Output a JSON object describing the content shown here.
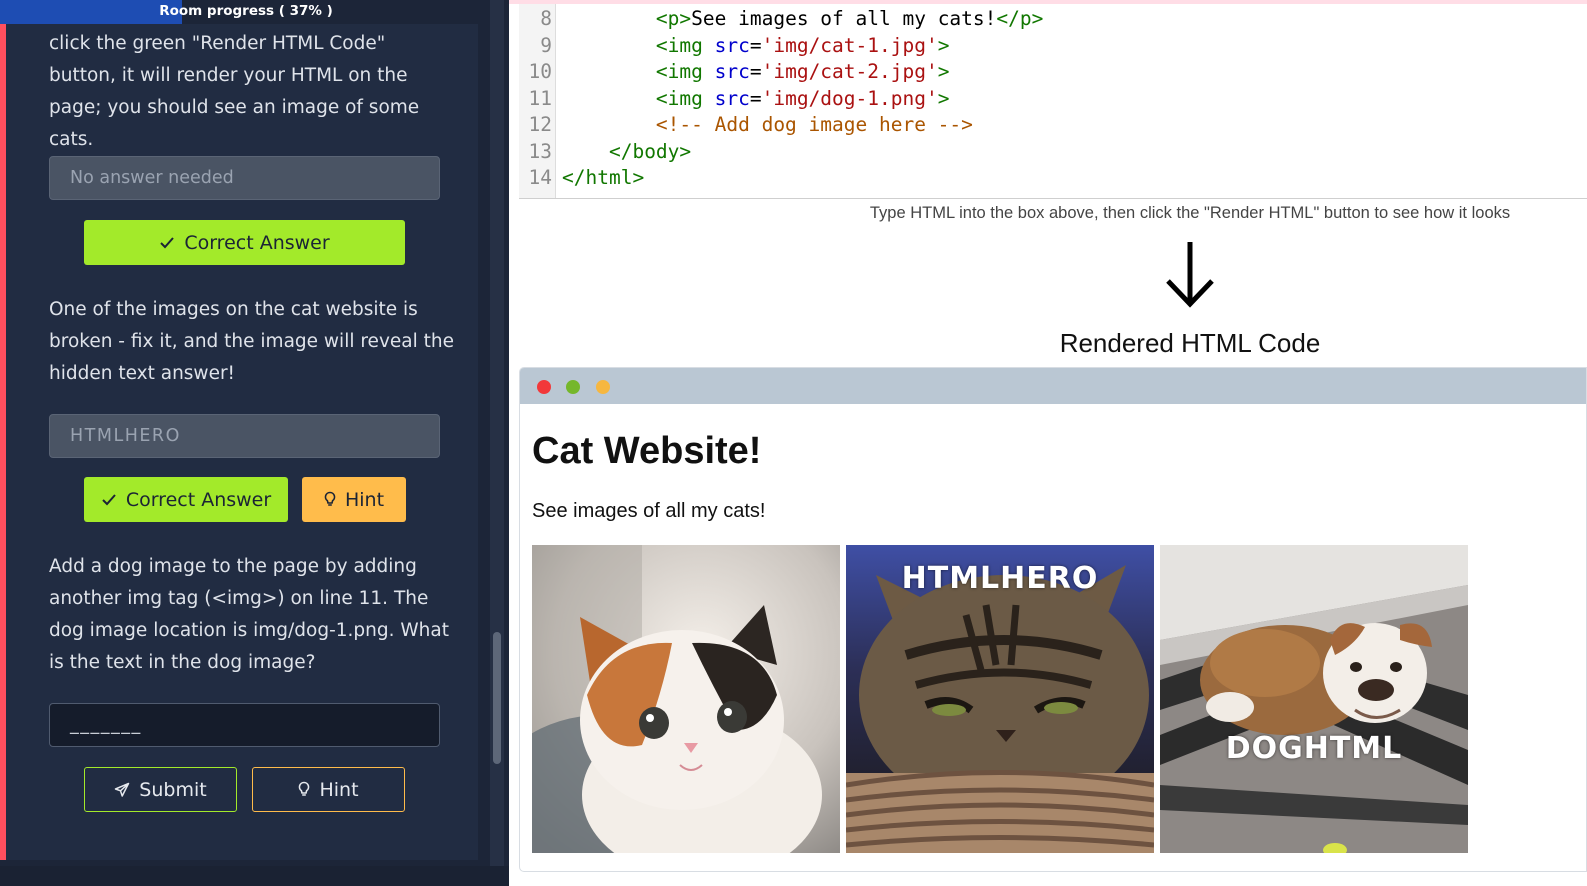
{
  "progress": {
    "label": "Room progress ( 37% )",
    "fraction": 0.37
  },
  "task": {
    "paragraph_0": "If you enter some HTML into the box and click the green \"Render HTML Code\" button, it will render your HTML on the page; you should see an image of some cats.",
    "answer_1": {
      "placeholder": "No answer needed"
    },
    "correct_label": "Correct Answer",
    "paragraph_1": "One of the images on the cat website is broken - fix it, and the image will reveal the hidden text answer!",
    "answer_2": {
      "value": "HTMLHERO"
    },
    "hint_label": "Hint",
    "paragraph_2": "Add a dog image to the page by adding another img tag (<img>) on line 11. The dog image location is img/dog-1.png. What is the text in the dog image?",
    "answer_3": {
      "value": "_______"
    },
    "submit_label": "Submit"
  },
  "editor": {
    "lines": [
      {
        "num": "8",
        "indent": "        ",
        "parts": [
          {
            "t": "tag",
            "v": "<p>"
          },
          {
            "t": "text",
            "v": "See images of all my cats!"
          },
          {
            "t": "tag",
            "v": "</p>"
          }
        ]
      },
      {
        "num": "9",
        "indent": "        ",
        "parts": [
          {
            "t": "tag",
            "v": "<img "
          },
          {
            "t": "attr",
            "v": "src"
          },
          {
            "t": "text",
            "v": "="
          },
          {
            "t": "str",
            "v": "'img/cat-1.jpg'"
          },
          {
            "t": "tag",
            "v": ">"
          }
        ]
      },
      {
        "num": "10",
        "indent": "        ",
        "parts": [
          {
            "t": "tag",
            "v": "<img "
          },
          {
            "t": "attr",
            "v": "src"
          },
          {
            "t": "text",
            "v": "="
          },
          {
            "t": "str",
            "v": "'img/cat-2.jpg'"
          },
          {
            "t": "tag",
            "v": ">"
          }
        ]
      },
      {
        "num": "11",
        "indent": "        ",
        "parts": [
          {
            "t": "tag",
            "v": "<img "
          },
          {
            "t": "attr",
            "v": "src"
          },
          {
            "t": "text",
            "v": "="
          },
          {
            "t": "str",
            "v": "'img/dog-1.png'"
          },
          {
            "t": "tag",
            "v": ">"
          }
        ]
      },
      {
        "num": "12",
        "indent": "        ",
        "parts": [
          {
            "t": "comment",
            "v": "<!-- Add dog image here -->"
          }
        ]
      },
      {
        "num": "13",
        "indent": "    ",
        "parts": [
          {
            "t": "tag",
            "v": "</body>"
          }
        ]
      },
      {
        "num": "14",
        "indent": "",
        "parts": [
          {
            "t": "tag",
            "v": "</html>"
          }
        ]
      }
    ]
  },
  "instructions": "Type HTML into the box above, then click the \"Render HTML\" button to see how it looks",
  "rendered_title": "Rendered HTML Code",
  "rendered_page": {
    "heading": "Cat Website!",
    "paragraph": "See images of all my cats!",
    "images": [
      {
        "name": "kitten-image",
        "overlay": ""
      },
      {
        "name": "tabby-cat-image",
        "overlay": "HTMLHERO"
      },
      {
        "name": "bulldog-image",
        "overlay": "DOGHTML"
      }
    ]
  },
  "colors": {
    "accent_red": "#ff4f5e",
    "correct_green": "#a3ea2a",
    "hint_yellow": "#ffbc4b",
    "progress_blue": "#1e4db3",
    "panel_bg": "#212c42"
  }
}
